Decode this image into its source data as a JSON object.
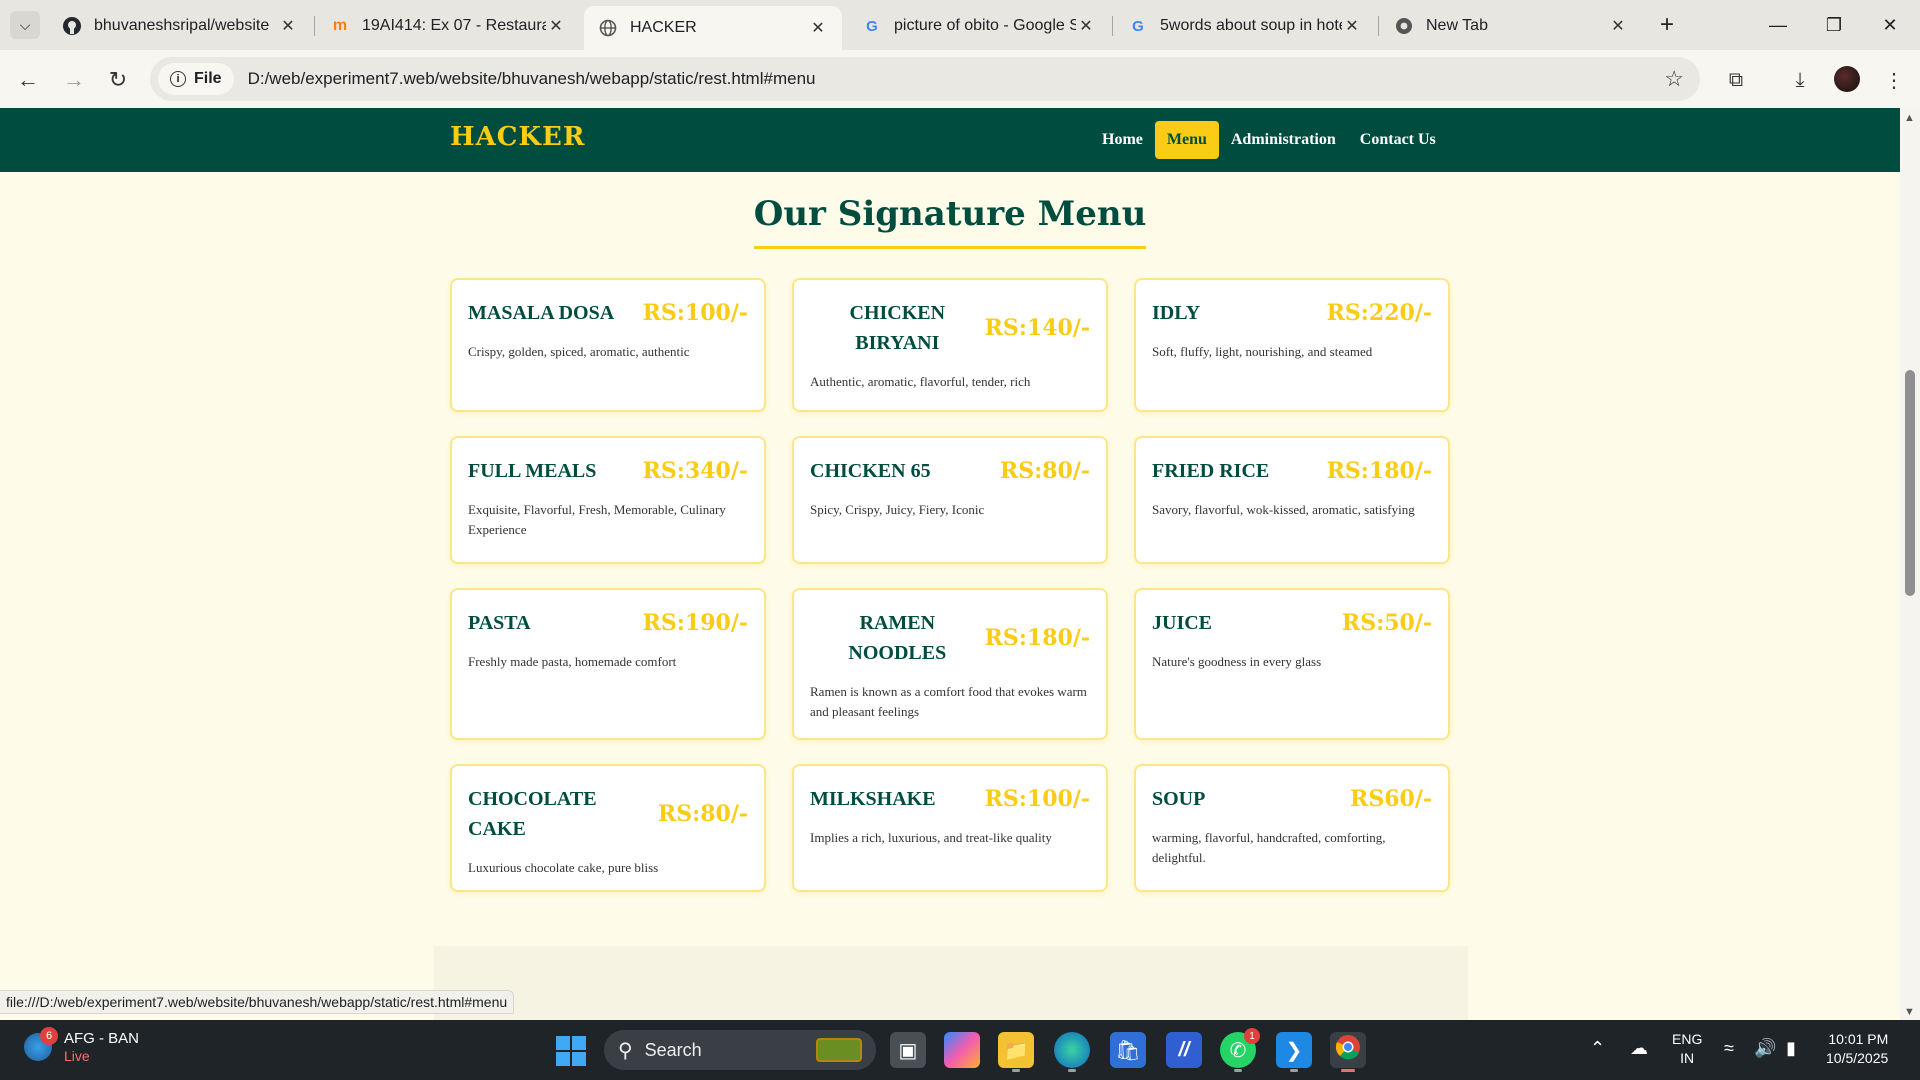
{
  "browser": {
    "tabs": [
      {
        "title": "bhuvaneshsripal/website",
        "favicon": "github-icon"
      },
      {
        "title": "19AI414: Ex 07 - Restauran",
        "favicon": "moodle-icon"
      },
      {
        "title": "HACKER",
        "favicon": "globe-icon",
        "active": true
      },
      {
        "title": "picture of obito - Google S",
        "favicon": "google-icon"
      },
      {
        "title": "5words about soup in hote",
        "favicon": "google-icon"
      },
      {
        "title": "New Tab",
        "favicon": "chrome-icon"
      }
    ],
    "address": {
      "chip_label": "File",
      "url": "D:/web/experiment7.web/website/bhuvanesh/webapp/static/rest.html#menu"
    },
    "status_url": "file:///D:/web/experiment7.web/website/bhuvanesh/webapp/static/rest.html#menu"
  },
  "site": {
    "brand": "HACKER",
    "nav": [
      {
        "label": "Home"
      },
      {
        "label": "Menu",
        "active": true
      },
      {
        "label": "Administration"
      },
      {
        "label": "Contact Us"
      }
    ],
    "section_title": "Our Signature Menu",
    "colors": {
      "primary": "#004d40",
      "accent": "#facc15",
      "background": "#fefce8"
    },
    "menu": [
      {
        "name": "MASALA DOSA",
        "price": "RS:100/-",
        "description": "Crispy, golden, spiced, aromatic, authentic"
      },
      {
        "name": "CHICKEN BIRYANI",
        "price": "RS:140/-",
        "description": "Authentic, aromatic, flavorful, tender, rich"
      },
      {
        "name": "IDLY",
        "price": "RS:220/-",
        "description": "Soft, fluffy, light, nourishing, and steamed"
      },
      {
        "name": "FULL MEALS",
        "price": "RS:340/-",
        "description": "Exquisite, Flavorful, Fresh, Memorable, Culinary Experience"
      },
      {
        "name": "CHICKEN 65",
        "price": "RS:80/-",
        "description": "Spicy, Crispy, Juicy, Fiery, Iconic"
      },
      {
        "name": "FRIED RICE",
        "price": "RS:180/-",
        "description": "Savory, flavorful, wok-kissed, aromatic, satisfying"
      },
      {
        "name": "PASTA",
        "price": "RS:190/-",
        "description": "Freshly made pasta, homemade comfort"
      },
      {
        "name": "RAMEN NOODLES",
        "price": "RS:180/-",
        "description": "Ramen is known as a comfort food that evokes warm and pleasant feelings"
      },
      {
        "name": "JUICE",
        "price": "RS:50/-",
        "description": "Nature's goodness in every glass"
      },
      {
        "name": "CHOCOLATE CAKE",
        "price": "RS:80/-",
        "description": "Luxurious chocolate cake, pure bliss"
      },
      {
        "name": "MILKSHAKE",
        "price": "RS:100/-",
        "description": "Implies a rich, luxurious, and treat-like quality"
      },
      {
        "name": "SOUP",
        "price": "RS60/-",
        "description": "warming, flavorful, handcrafted, comforting, delightful."
      }
    ]
  },
  "taskbar": {
    "weather_title": "AFG - BAN",
    "weather_sub": "Live",
    "weather_badge": "6",
    "search_label": "Search",
    "whatsapp_badge": "1",
    "lang_line1": "ENG",
    "lang_line2": "IN",
    "time": "10:01 PM",
    "date": "10/5/2025"
  }
}
